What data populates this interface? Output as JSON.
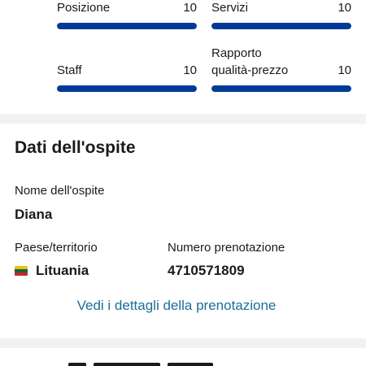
{
  "scores": {
    "items": [
      {
        "label": "Posizione",
        "value": "10",
        "fraction": 1.0
      },
      {
        "label": "Servizi",
        "value": "10",
        "fraction": 1.0
      },
      {
        "label": "Staff",
        "value": "10",
        "fraction": 1.0
      },
      {
        "label_line1": "Rapporto",
        "label_line2": "qualità-prezzo",
        "value": "10",
        "fraction": 1.0
      }
    ],
    "bar_color": "#003b95"
  },
  "guest": {
    "title": "Dati dell'ospite",
    "name_label": "Nome dell'ospite",
    "name_value": "Diana",
    "country_label": "Paese/territorio",
    "country_value": "Lituania",
    "country_flag": "lithuania-flag-icon",
    "flag_colors": [
      "#fdb913",
      "#006a44",
      "#c1272d"
    ],
    "booking_label": "Numero prenotazione",
    "booking_value": "4710571809",
    "details_link": "Vedi i dettagli della prenotazione",
    "link_color": "#1b6e9c"
  },
  "colors": {
    "divider": "#f2f2f2",
    "text": "#1a1a1a"
  }
}
